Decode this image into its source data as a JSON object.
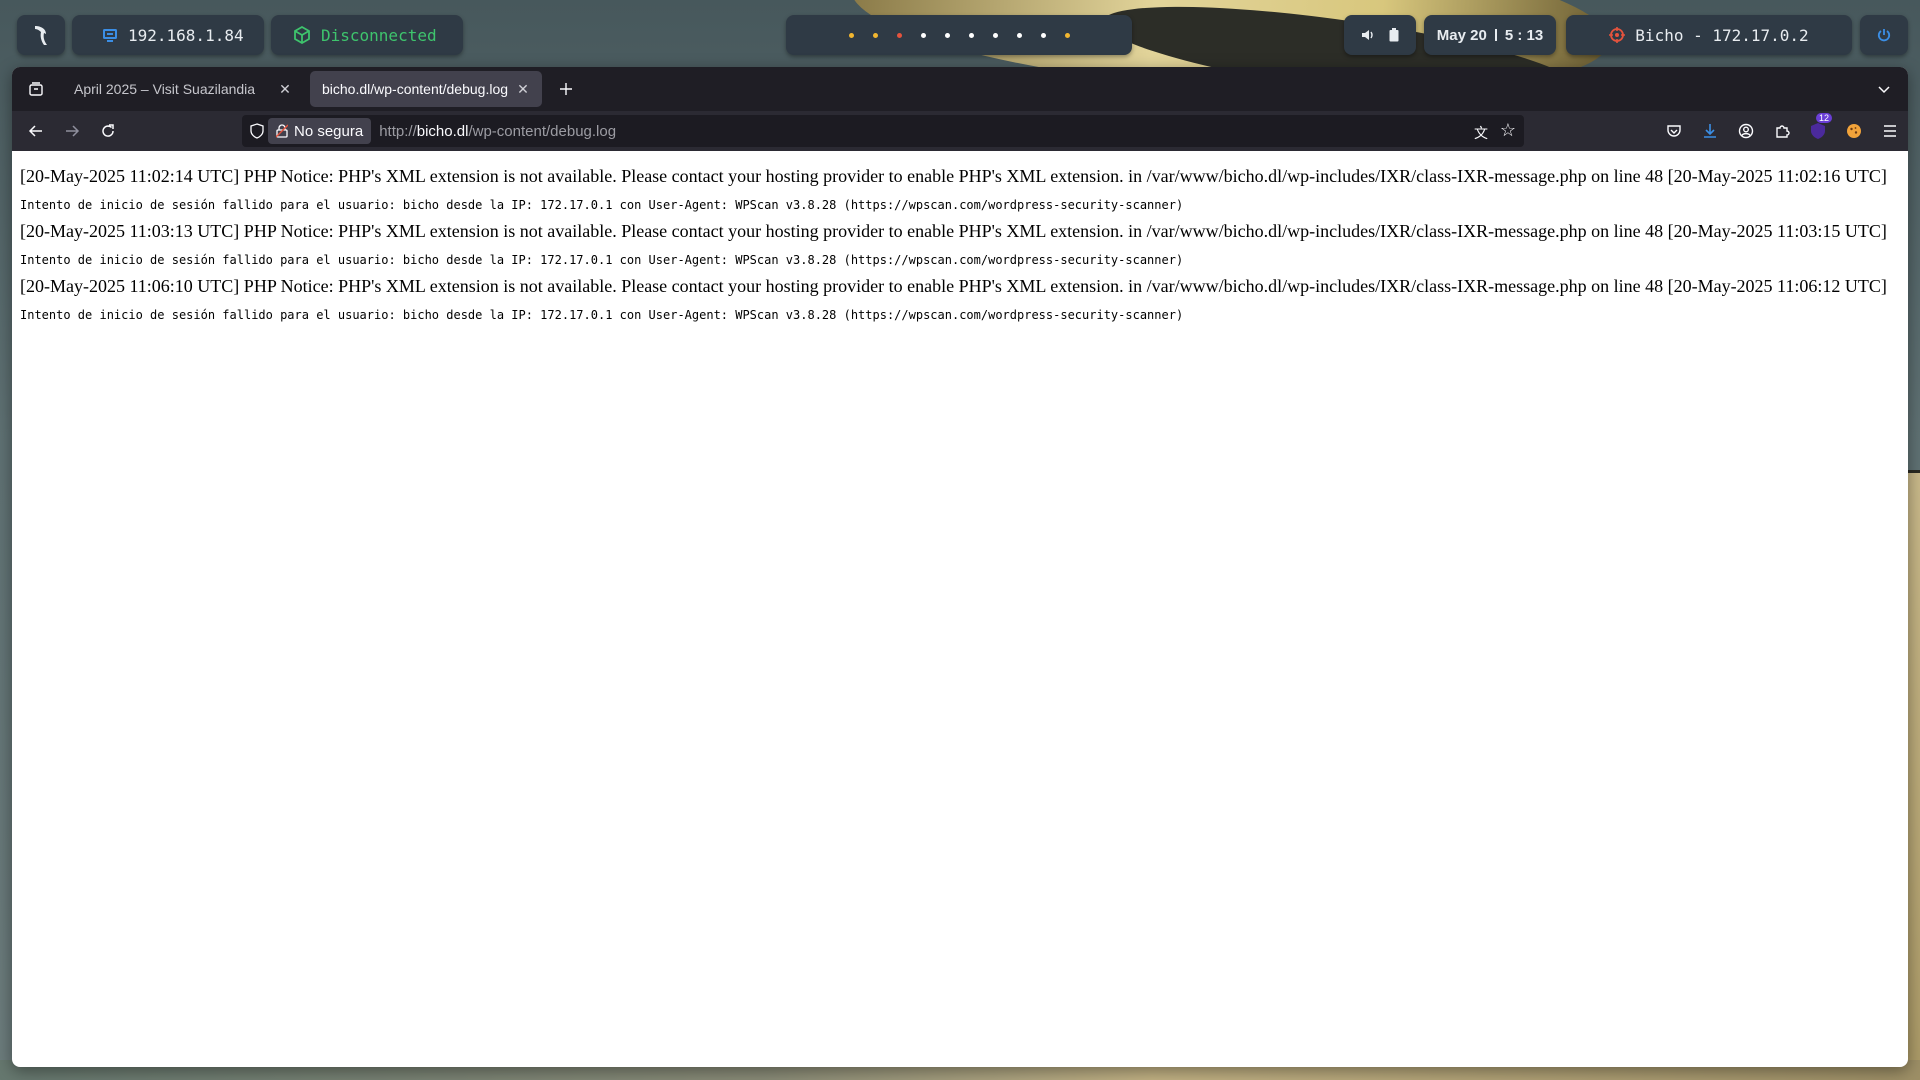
{
  "topbar": {
    "ip": "192.168.1.84",
    "vpn_status": "Disconnected",
    "date": "May 20",
    "time": "5 : 13",
    "target": "Bicho - 172.17.0.2",
    "workspace_dot_colors": [
      "#f2b630",
      "#f2b630",
      "#e5533d",
      "#ffffff",
      "#ffffff",
      "#ffffff",
      "#ffffff",
      "#ffffff",
      "#ffffff",
      "#f2b630"
    ]
  },
  "tabs": [
    {
      "title": "April 2025 – Visit Suazilandia",
      "active": false
    },
    {
      "title": "bicho.dl/wp-content/debug.log",
      "active": true
    }
  ],
  "urlbar": {
    "security_label": "No segura",
    "url_prefix": "http://",
    "url_host": "bicho.dl",
    "url_path": "/wp-content/debug.log"
  },
  "toolbar": {
    "extension_badge": "12"
  },
  "log": [
    {
      "notice": "[20-May-2025 11:02:14 UTC] PHP Notice: PHP's XML extension is not available. Please contact your hosting provider to enable PHP's XML extension. in /var/www/bicho.dl/wp-includes/IXR/class-IXR-message.php on line 48 [20-May-2025 11:02:16 UTC]",
      "attempt": "Intento de inicio de sesión fallido para el usuario: bicho desde la IP: 172.17.0.1 con User-Agent: WPScan v3.8.28 (https://wpscan.com/wordpress-security-scanner)"
    },
    {
      "notice": "[20-May-2025 11:03:13 UTC] PHP Notice: PHP's XML extension is not available. Please contact your hosting provider to enable PHP's XML extension. in /var/www/bicho.dl/wp-includes/IXR/class-IXR-message.php on line 48 [20-May-2025 11:03:15 UTC]",
      "attempt": "Intento de inicio de sesión fallido para el usuario: bicho desde la IP: 172.17.0.1 con User-Agent: WPScan v3.8.28 (https://wpscan.com/wordpress-security-scanner)"
    },
    {
      "notice": "[20-May-2025 11:06:10 UTC] PHP Notice: PHP's XML extension is not available. Please contact your hosting provider to enable PHP's XML extension. in /var/www/bicho.dl/wp-includes/IXR/class-IXR-message.php on line 48 [20-May-2025 11:06:12 UTC]",
      "attempt": "Intento de inicio de sesión fallido para el usuario: bicho desde la IP: 172.17.0.1 con User-Agent: WPScan v3.8.28 (https://wpscan.com/wordpress-security-scanner)"
    }
  ]
}
